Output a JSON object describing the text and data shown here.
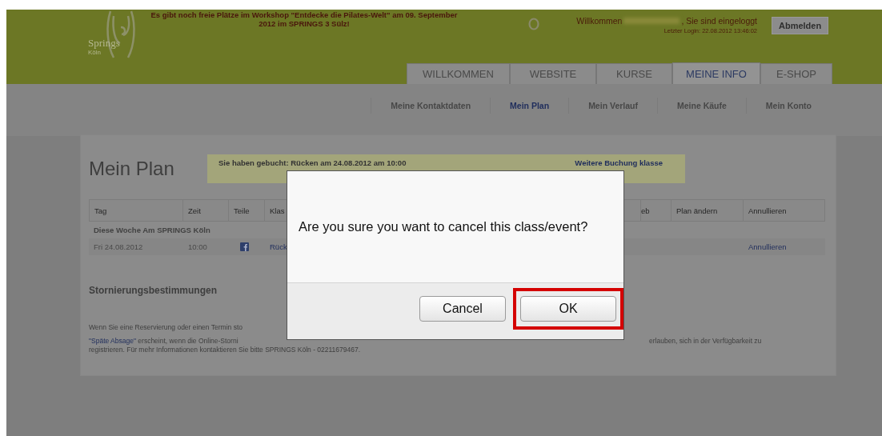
{
  "banner": {
    "logo": {
      "name": "Springs",
      "city": "Köln"
    },
    "announcement_lines": [
      "Es gibt noch freie Plätze im Workshop \"Entdecke die Pilates-Welt\" am 09. September",
      "2012 im SPRINGS 3 Sülz!"
    ],
    "welcome": "Willkommen",
    "logged_in": ", Sie sind eingeloggt",
    "last_login": "Letzter Login: 22.08.2012 13:46:02",
    "logout_button": "Abmelden"
  },
  "tabs": [
    {
      "label": "WILLKOMMEN",
      "selected": false
    },
    {
      "label": "WEBSITE",
      "selected": false
    },
    {
      "label": "KURSE",
      "selected": false
    },
    {
      "label": "MEINE INFO",
      "selected": true
    },
    {
      "label": "E-SHOP",
      "selected": false
    }
  ],
  "subnav": [
    {
      "label": "Meine Kontaktdaten",
      "selected": false
    },
    {
      "label": "Mein Plan",
      "selected": true
    },
    {
      "label": "Mein Verlauf",
      "selected": false
    },
    {
      "label": "Meine Käufe",
      "selected": false
    },
    {
      "label": "Mein Konto",
      "selected": false
    }
  ],
  "page": {
    "title": "Mein Plan",
    "notice": "Sie haben gebucht: Rücken am 24.08.2012 am 10:00",
    "more_link": "Weitere Buchung klasse"
  },
  "table": {
    "columns": [
      "Tag",
      "Zeit",
      "Teile",
      "Klas",
      "eb",
      "Plan ändern",
      "Annullieren"
    ],
    "group": "Diese Woche Am SPRINGS Köln",
    "rows": [
      {
        "tag": "Fri 24.08.2012",
        "zeit": "10:00",
        "klasse": "Rück",
        "annullieren": "Annullieren"
      }
    ]
  },
  "policy": {
    "heading": "Stornierungsbestimmungen",
    "line_1": "Wenn Sie eine Reservierung oder einen Termin sto",
    "line_2_link": "\"Späte Absage\"",
    "line_2_text": " erscheint, wenn die Online-Storni",
    "line_2_right": "erlauben, sich in der Verfügbarkeit zu",
    "line_3": "registrieren. Für mehr Informationen kontaktieren Sie bitte SPRINGS Köln - 02211679467."
  },
  "dialog": {
    "message": "Are you sure you want to cancel this class/event?",
    "buttons": [
      {
        "label": "Cancel",
        "highlighted": false
      },
      {
        "label": "OK",
        "highlighted": true
      }
    ]
  }
}
